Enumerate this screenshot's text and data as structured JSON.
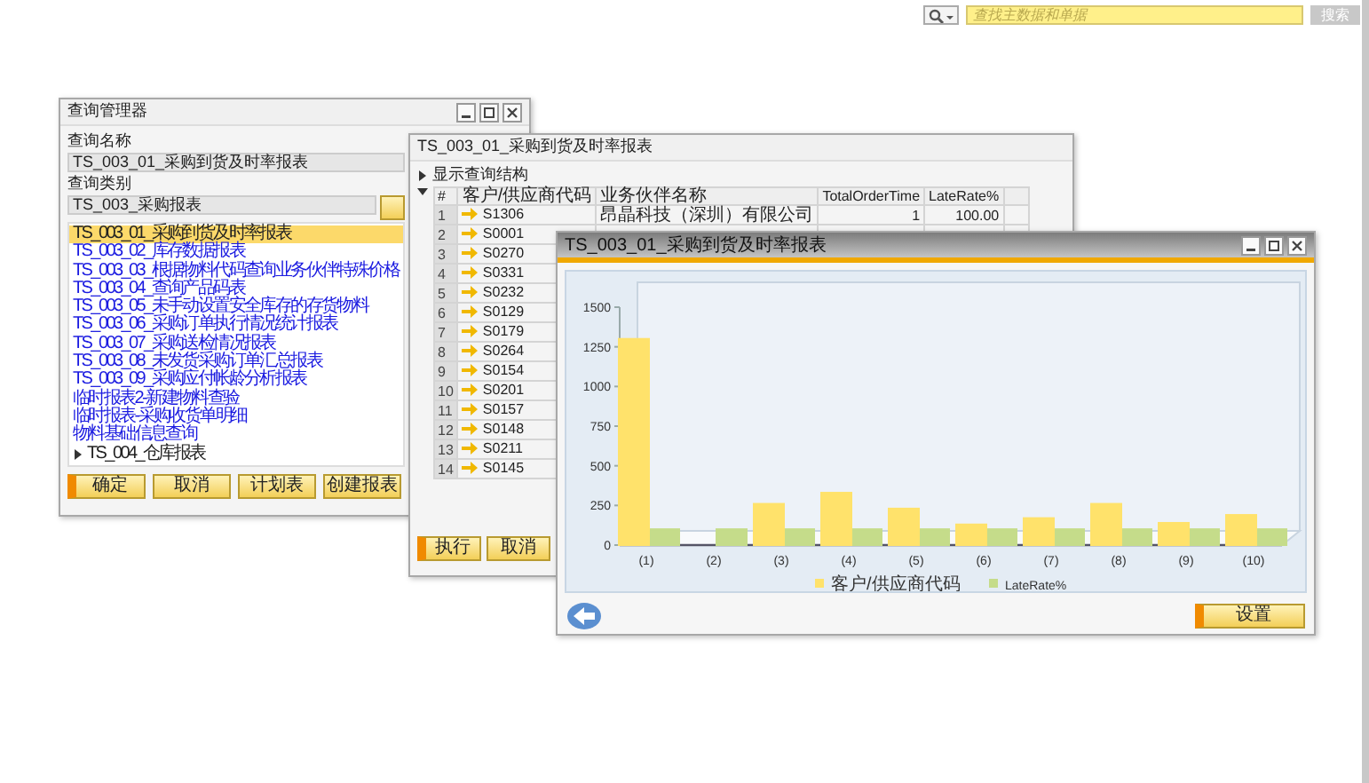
{
  "search": {
    "placeholder": "查找主数据和单据",
    "button": "搜索"
  },
  "query_manager": {
    "title": "查询管理器",
    "name_label": "查询名称",
    "name_value": "TS_003_01_采购到货及时率报表",
    "category_label": "查询类别",
    "category_value": "TS_003_采购报表",
    "queries": [
      {
        "label": "TS_003_01_采购到货及时率报表",
        "kind": "query",
        "selected": true
      },
      {
        "label": "TS_003_02_库存数据报表",
        "kind": "query",
        "selected": false
      },
      {
        "label": "TS_003_03_根据物料代码查询业务伙伴特殊价格",
        "kind": "query",
        "selected": false
      },
      {
        "label": "TS_003_04_查询产品码表",
        "kind": "query",
        "selected": false
      },
      {
        "label": "TS_003_05_未手动设置安全库存的存货物料",
        "kind": "query",
        "selected": false
      },
      {
        "label": "TS_003_06_采购订单执行情况统计报表",
        "kind": "query",
        "selected": false
      },
      {
        "label": "TS_003_07_采购送检情况报表",
        "kind": "query",
        "selected": false
      },
      {
        "label": "TS_003_08_未发货采购订单汇总报表",
        "kind": "query",
        "selected": false
      },
      {
        "label": "TS_003_09_采购应付帐龄分析报表",
        "kind": "query",
        "selected": false
      },
      {
        "label": "临时报表2-新建物料查验",
        "kind": "query",
        "selected": false
      },
      {
        "label": "临时报表-采购收货单明细",
        "kind": "query",
        "selected": false
      },
      {
        "label": "物料基础信息查询",
        "kind": "query",
        "selected": false
      },
      {
        "label": "TS_004_仓库报表",
        "kind": "folder",
        "selected": false,
        "expanded": false
      }
    ],
    "buttons": [
      {
        "label": "确定",
        "default": true
      },
      {
        "label": "取消",
        "default": false
      },
      {
        "label": "计划表",
        "default": false
      },
      {
        "label": "创建报表",
        "default": false
      }
    ]
  },
  "query_result": {
    "title": "TS_003_01_采购到货及时率报表",
    "structure_toggle": {
      "label": "显示查询结构",
      "expanded": false
    },
    "columns": [
      "#",
      "客户/供应商代码",
      "业务伙伴名称",
      "TotalOrderTime",
      "LateRate%"
    ],
    "rows": [
      {
        "cells": [
          "1",
          "S1306",
          "昂晶科技（深圳）有限公司",
          "1",
          "100.00"
        ]
      },
      {
        "cells": [
          "2",
          "S0001"
        ]
      },
      {
        "cells": [
          "3",
          "S0270"
        ]
      },
      {
        "cells": [
          "4",
          "S0331"
        ]
      },
      {
        "cells": [
          "5",
          "S0232"
        ]
      },
      {
        "cells": [
          "6",
          "S0129"
        ]
      },
      {
        "cells": [
          "7",
          "S0179"
        ]
      },
      {
        "cells": [
          "8",
          "S0264"
        ]
      },
      {
        "cells": [
          "9",
          "S0154"
        ]
      },
      {
        "cells": [
          "10",
          "S0201"
        ]
      },
      {
        "cells": [
          "11",
          "S0157"
        ]
      },
      {
        "cells": [
          "12",
          "S0148"
        ]
      },
      {
        "cells": [
          "13",
          "S0211"
        ]
      },
      {
        "cells": [
          "14",
          "S0145"
        ]
      }
    ],
    "buttons": [
      {
        "label": "执行",
        "default": true
      },
      {
        "label": "取消",
        "default": false
      }
    ]
  },
  "chart_window": {
    "title": "TS_003_01_采购到货及时率报表",
    "chart_data": {
      "type": "bar",
      "categories": [
        "(1)",
        "(2)",
        "(3)",
        "(4)",
        "(5)",
        "(6)",
        "(7)",
        "(8)",
        "(9)",
        "(10)"
      ],
      "series": [
        {
          "name": "客户/供应商代码",
          "color": "#ffe26b",
          "values": [
            1300,
            0,
            260,
            330,
            230,
            130,
            170,
            260,
            140,
            190
          ]
        },
        {
          "name": "LateRate%",
          "color": "#c5dc8a",
          "values": [
            100,
            100,
            100,
            100,
            100,
            100,
            100,
            100,
            100,
            100
          ]
        }
      ],
      "ylim": [
        0,
        1500
      ],
      "legend": "bottom",
      "yticks": [
        0,
        250,
        500,
        750,
        1000,
        1250,
        1500
      ]
    },
    "button": {
      "label": "设置",
      "default": true
    }
  }
}
